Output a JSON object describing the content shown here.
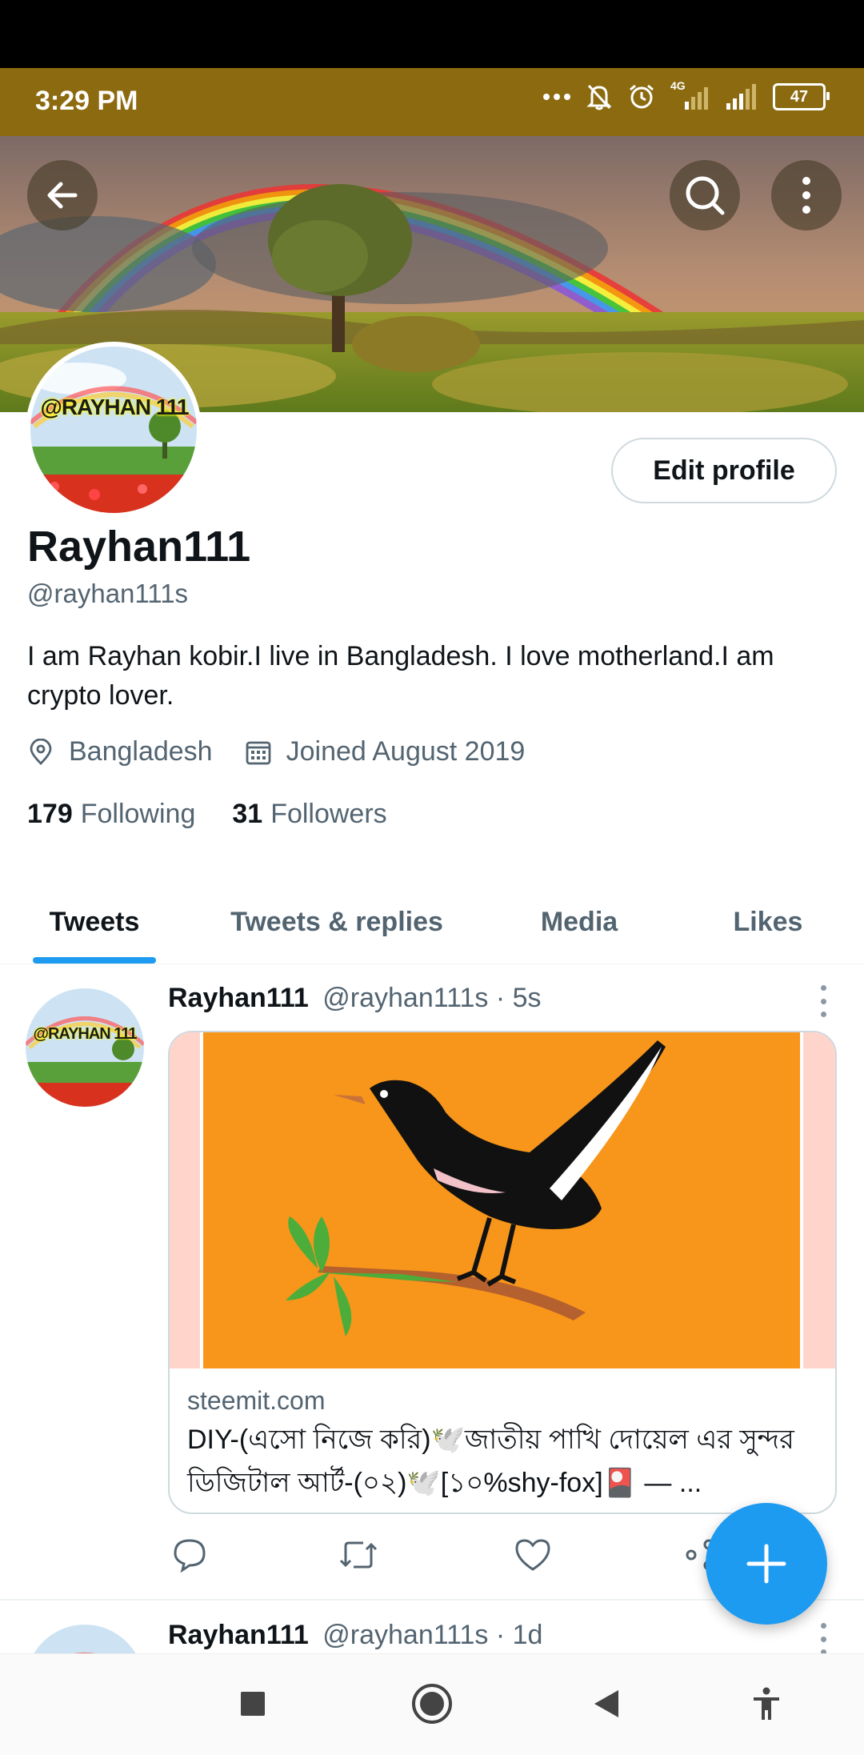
{
  "status_bar": {
    "time": "3:29 PM",
    "network": "4G",
    "battery": "47"
  },
  "profile": {
    "name": "Rayhan111",
    "handle": "@rayhan111s",
    "avatar_text": "@RAYHAN 111",
    "bio": "I am Rayhan kobir.I live in Bangladesh. I love motherland.I am crypto lover.",
    "location": "Bangladesh",
    "joined": "Joined August 2019",
    "following_count": "179",
    "following_label": "Following",
    "followers_count": "31",
    "followers_label": "Followers",
    "edit_label": "Edit profile"
  },
  "tabs": [
    {
      "label": "Tweets",
      "active": true
    },
    {
      "label": "Tweets & replies",
      "active": false
    },
    {
      "label": "Media",
      "active": false
    },
    {
      "label": "Likes",
      "active": false
    }
  ],
  "tweets": [
    {
      "name": "Rayhan111",
      "handle": "@rayhan111s",
      "time": "· 5s",
      "card": {
        "domain": "steemit.com",
        "title": "DIY-(এসো নিজে করি)🕊️জাতীয় পাখি দোয়েল এর সুন্দর ডিজিটাল আর্ট-(০২)🕊️[১০%shy-fox]🎴 — ..."
      }
    },
    {
      "name": "Rayhan111",
      "handle": "@rayhan111s",
      "time": "· 1d"
    }
  ],
  "icons": {
    "back": "back-arrow-icon",
    "search": "search-icon",
    "more": "more-vertical-icon",
    "location": "location-pin-icon",
    "calendar": "calendar-icon",
    "reply": "reply-icon",
    "retweet": "retweet-icon",
    "like": "heart-icon",
    "share": "share-icon",
    "compose": "plus-icon"
  },
  "colors": {
    "accent": "#1d9bf0",
    "status_bar": "#8c6a10",
    "card_image_bg": "#f7961a"
  }
}
